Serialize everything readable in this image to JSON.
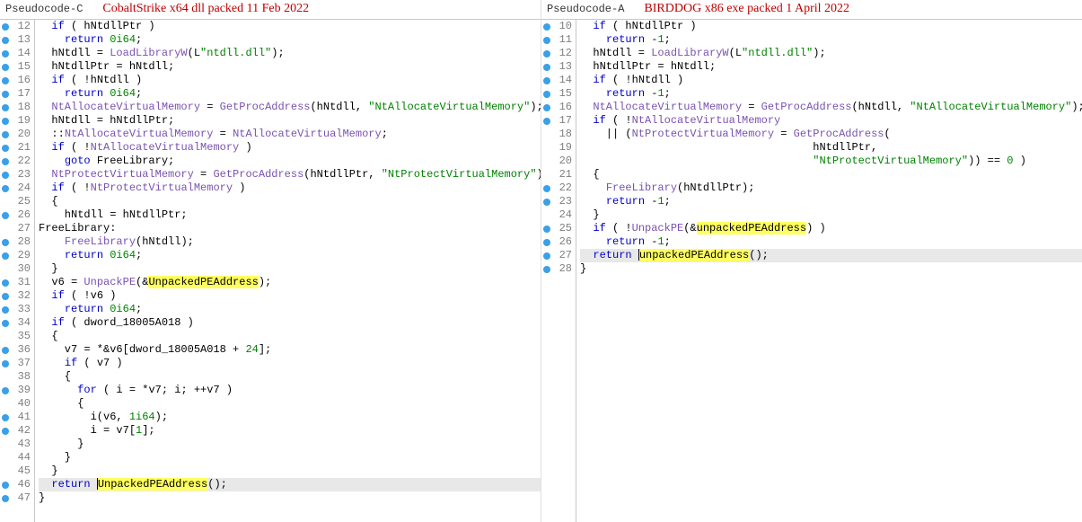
{
  "left": {
    "tab": "Pseudocode-C",
    "title": "CobaltStrike x64 dll packed 11 Feb 2022",
    "lines": [
      {
        "n": 12,
        "bp": true,
        "seg": [
          {
            "t": "  "
          },
          {
            "t": "if",
            "c": "kw"
          },
          {
            "t": " ( hNtdllPtr )"
          }
        ]
      },
      {
        "n": 13,
        "bp": true,
        "seg": [
          {
            "t": "    "
          },
          {
            "t": "return",
            "c": "kw"
          },
          {
            "t": " "
          },
          {
            "t": "0i64",
            "c": "num-lit"
          },
          {
            "t": ";"
          }
        ]
      },
      {
        "n": 14,
        "bp": true,
        "seg": [
          {
            "t": "  hNtdll = "
          },
          {
            "t": "LoadLibraryW",
            "c": "fn"
          },
          {
            "t": "(L"
          },
          {
            "t": "\"ntdll.dll\"",
            "c": "str"
          },
          {
            "t": ");"
          }
        ]
      },
      {
        "n": 15,
        "bp": true,
        "seg": [
          {
            "t": "  hNtdllPtr = hNtdll;"
          }
        ]
      },
      {
        "n": 16,
        "bp": true,
        "seg": [
          {
            "t": "  "
          },
          {
            "t": "if",
            "c": "kw"
          },
          {
            "t": " ( !hNtdll )"
          }
        ]
      },
      {
        "n": 17,
        "bp": true,
        "seg": [
          {
            "t": "    "
          },
          {
            "t": "return",
            "c": "kw"
          },
          {
            "t": " "
          },
          {
            "t": "0i64",
            "c": "num-lit"
          },
          {
            "t": ";"
          }
        ]
      },
      {
        "n": 18,
        "bp": true,
        "seg": [
          {
            "t": "  "
          },
          {
            "t": "NtAllocateVirtualMemory",
            "c": "fn"
          },
          {
            "t": " = "
          },
          {
            "t": "GetProcAddress",
            "c": "fn"
          },
          {
            "t": "(hNtdll, "
          },
          {
            "t": "\"NtAllocateVirtualMemory\"",
            "c": "str"
          },
          {
            "t": ");"
          }
        ]
      },
      {
        "n": 19,
        "bp": true,
        "seg": [
          {
            "t": "  hNtdll = hNtdllPtr;"
          }
        ]
      },
      {
        "n": 20,
        "bp": true,
        "seg": [
          {
            "t": "  ::"
          },
          {
            "t": "NtAllocateVirtualMemory",
            "c": "fn"
          },
          {
            "t": " = "
          },
          {
            "t": "NtAllocateVirtualMemory",
            "c": "fn"
          },
          {
            "t": ";"
          }
        ]
      },
      {
        "n": 21,
        "bp": true,
        "seg": [
          {
            "t": "  "
          },
          {
            "t": "if",
            "c": "kw"
          },
          {
            "t": " ( !"
          },
          {
            "t": "NtAllocateVirtualMemory",
            "c": "fn"
          },
          {
            "t": " )"
          }
        ]
      },
      {
        "n": 22,
        "bp": true,
        "seg": [
          {
            "t": "    "
          },
          {
            "t": "goto",
            "c": "kw"
          },
          {
            "t": " FreeLibrary;"
          }
        ]
      },
      {
        "n": 23,
        "bp": true,
        "seg": [
          {
            "t": "  "
          },
          {
            "t": "NtProtectVirtualMemory",
            "c": "fn"
          },
          {
            "t": " = "
          },
          {
            "t": "GetProcAddress",
            "c": "fn"
          },
          {
            "t": "(hNtdllPtr, "
          },
          {
            "t": "\"NtProtectVirtualMemory\"",
            "c": "str"
          },
          {
            "t": ");"
          }
        ]
      },
      {
        "n": 24,
        "bp": true,
        "seg": [
          {
            "t": "  "
          },
          {
            "t": "if",
            "c": "kw"
          },
          {
            "t": " ( !"
          },
          {
            "t": "NtProtectVirtualMemory",
            "c": "fn"
          },
          {
            "t": " )"
          }
        ]
      },
      {
        "n": 25,
        "bp": false,
        "seg": [
          {
            "t": "  {"
          }
        ]
      },
      {
        "n": 26,
        "bp": true,
        "seg": [
          {
            "t": "    hNtdll = hNtdllPtr;"
          }
        ]
      },
      {
        "n": 27,
        "bp": false,
        "seg": [
          {
            "t": "FreeLibrary:"
          }
        ]
      },
      {
        "n": 28,
        "bp": true,
        "seg": [
          {
            "t": "    "
          },
          {
            "t": "FreeLibrary",
            "c": "fn"
          },
          {
            "t": "(hNtdll);"
          }
        ]
      },
      {
        "n": 29,
        "bp": true,
        "seg": [
          {
            "t": "    "
          },
          {
            "t": "return",
            "c": "kw"
          },
          {
            "t": " "
          },
          {
            "t": "0i64",
            "c": "num-lit"
          },
          {
            "t": ";"
          }
        ]
      },
      {
        "n": 30,
        "bp": false,
        "seg": [
          {
            "t": "  }"
          }
        ]
      },
      {
        "n": 31,
        "bp": true,
        "seg": [
          {
            "t": "  v6 = "
          },
          {
            "t": "UnpackPE",
            "c": "fn"
          },
          {
            "t": "(&"
          },
          {
            "t": "UnpackedPEAddress",
            "hi": true
          },
          {
            "t": ");"
          }
        ]
      },
      {
        "n": 32,
        "bp": true,
        "seg": [
          {
            "t": "  "
          },
          {
            "t": "if",
            "c": "kw"
          },
          {
            "t": " ( !v6 )"
          }
        ]
      },
      {
        "n": 33,
        "bp": true,
        "seg": [
          {
            "t": "    "
          },
          {
            "t": "return",
            "c": "kw"
          },
          {
            "t": " "
          },
          {
            "t": "0i64",
            "c": "num-lit"
          },
          {
            "t": ";"
          }
        ]
      },
      {
        "n": 34,
        "bp": true,
        "seg": [
          {
            "t": "  "
          },
          {
            "t": "if",
            "c": "kw"
          },
          {
            "t": " ( dword_18005A018 )"
          }
        ]
      },
      {
        "n": 35,
        "bp": false,
        "seg": [
          {
            "t": "  {"
          }
        ]
      },
      {
        "n": 36,
        "bp": true,
        "seg": [
          {
            "t": "    v7 = *&v6[dword_18005A018 + "
          },
          {
            "t": "24",
            "c": "num-lit"
          },
          {
            "t": "];"
          }
        ]
      },
      {
        "n": 37,
        "bp": true,
        "seg": [
          {
            "t": "    "
          },
          {
            "t": "if",
            "c": "kw"
          },
          {
            "t": " ( v7 )"
          }
        ]
      },
      {
        "n": 38,
        "bp": false,
        "seg": [
          {
            "t": "    {"
          }
        ]
      },
      {
        "n": 39,
        "bp": true,
        "seg": [
          {
            "t": "      "
          },
          {
            "t": "for",
            "c": "kw"
          },
          {
            "t": " ( i = *v7; i; ++v7 )"
          }
        ]
      },
      {
        "n": 40,
        "bp": false,
        "seg": [
          {
            "t": "      {"
          }
        ]
      },
      {
        "n": 41,
        "bp": true,
        "seg": [
          {
            "t": "        i(v6, "
          },
          {
            "t": "1i64",
            "c": "num-lit"
          },
          {
            "t": ");"
          }
        ]
      },
      {
        "n": 42,
        "bp": true,
        "seg": [
          {
            "t": "        i = v7["
          },
          {
            "t": "1",
            "c": "num-lit"
          },
          {
            "t": "];"
          }
        ]
      },
      {
        "n": 43,
        "bp": false,
        "seg": [
          {
            "t": "      }"
          }
        ]
      },
      {
        "n": 44,
        "bp": false,
        "seg": [
          {
            "t": "    }"
          }
        ]
      },
      {
        "n": 45,
        "bp": false,
        "seg": [
          {
            "t": "  }"
          }
        ]
      },
      {
        "n": 46,
        "bp": true,
        "cur": true,
        "seg": [
          {
            "t": "  "
          },
          {
            "t": "return",
            "c": "kw"
          },
          {
            "t": " "
          },
          {
            "caret": true
          },
          {
            "t": "UnpackedPEAddress",
            "hi": true
          },
          {
            "t": "();"
          }
        ]
      },
      {
        "n": 47,
        "bp": true,
        "seg": [
          {
            "t": "}"
          }
        ]
      }
    ]
  },
  "right": {
    "tab": "Pseudocode-A",
    "title": "BIRDDOG x86 exe packed 1 April 2022",
    "lines": [
      {
        "n": 10,
        "bp": true,
        "seg": [
          {
            "t": "  "
          },
          {
            "t": "if",
            "c": "kw"
          },
          {
            "t": " ( hNtdllPtr )"
          }
        ]
      },
      {
        "n": 11,
        "bp": true,
        "seg": [
          {
            "t": "    "
          },
          {
            "t": "return",
            "c": "kw"
          },
          {
            "t": " -"
          },
          {
            "t": "1",
            "c": "num-lit"
          },
          {
            "t": ";"
          }
        ]
      },
      {
        "n": 12,
        "bp": true,
        "seg": [
          {
            "t": "  hNtdll = "
          },
          {
            "t": "LoadLibraryW",
            "c": "fn"
          },
          {
            "t": "(L"
          },
          {
            "t": "\"ntdll.dll\"",
            "c": "str"
          },
          {
            "t": ");"
          }
        ]
      },
      {
        "n": 13,
        "bp": true,
        "seg": [
          {
            "t": "  hNtdllPtr = hNtdll;"
          }
        ]
      },
      {
        "n": 14,
        "bp": true,
        "seg": [
          {
            "t": "  "
          },
          {
            "t": "if",
            "c": "kw"
          },
          {
            "t": " ( !hNtdll )"
          }
        ]
      },
      {
        "n": 15,
        "bp": true,
        "seg": [
          {
            "t": "    "
          },
          {
            "t": "return",
            "c": "kw"
          },
          {
            "t": " -"
          },
          {
            "t": "1",
            "c": "num-lit"
          },
          {
            "t": ";"
          }
        ]
      },
      {
        "n": 16,
        "bp": true,
        "seg": [
          {
            "t": "  "
          },
          {
            "t": "NtAllocateVirtualMemory",
            "c": "fn"
          },
          {
            "t": " = "
          },
          {
            "t": "GetProcAddress",
            "c": "fn"
          },
          {
            "t": "(hNtdll, "
          },
          {
            "t": "\"NtAllocateVirtualMemory\"",
            "c": "str"
          },
          {
            "t": ");"
          }
        ]
      },
      {
        "n": 17,
        "bp": true,
        "seg": [
          {
            "t": "  "
          },
          {
            "t": "if",
            "c": "kw"
          },
          {
            "t": " ( !"
          },
          {
            "t": "NtAllocateVirtualMemory",
            "c": "fn"
          }
        ]
      },
      {
        "n": 18,
        "bp": false,
        "seg": [
          {
            "t": "    || ("
          },
          {
            "t": "NtProtectVirtualMemory",
            "c": "fn"
          },
          {
            "t": " = "
          },
          {
            "t": "GetProcAddress",
            "c": "fn"
          },
          {
            "t": "("
          }
        ]
      },
      {
        "n": 19,
        "bp": false,
        "seg": [
          {
            "t": "                                    hNtdllPtr,"
          }
        ]
      },
      {
        "n": 20,
        "bp": false,
        "seg": [
          {
            "t": "                                    "
          },
          {
            "t": "\"NtProtectVirtualMemory\"",
            "c": "str"
          },
          {
            "t": ")) == "
          },
          {
            "t": "0",
            "c": "num-lit"
          },
          {
            "t": " )"
          }
        ]
      },
      {
        "n": 21,
        "bp": false,
        "seg": [
          {
            "t": "  {"
          }
        ]
      },
      {
        "n": 22,
        "bp": true,
        "seg": [
          {
            "t": "    "
          },
          {
            "t": "FreeLibrary",
            "c": "fn"
          },
          {
            "t": "(hNtdllPtr);"
          }
        ]
      },
      {
        "n": 23,
        "bp": true,
        "seg": [
          {
            "t": "    "
          },
          {
            "t": "return",
            "c": "kw"
          },
          {
            "t": " -"
          },
          {
            "t": "1",
            "c": "num-lit"
          },
          {
            "t": ";"
          }
        ]
      },
      {
        "n": 24,
        "bp": false,
        "seg": [
          {
            "t": "  }"
          }
        ]
      },
      {
        "n": 25,
        "bp": true,
        "seg": [
          {
            "t": "  "
          },
          {
            "t": "if",
            "c": "kw"
          },
          {
            "t": " ( !"
          },
          {
            "t": "UnpackPE",
            "c": "fn"
          },
          {
            "t": "(&"
          },
          {
            "t": "unpackedPEAddress",
            "hi": true
          },
          {
            "t": ") )"
          }
        ]
      },
      {
        "n": 26,
        "bp": true,
        "seg": [
          {
            "t": "    "
          },
          {
            "t": "return",
            "c": "kw"
          },
          {
            "t": " -"
          },
          {
            "t": "1",
            "c": "num-lit"
          },
          {
            "t": ";"
          }
        ]
      },
      {
        "n": 27,
        "bp": true,
        "cur": true,
        "seg": [
          {
            "t": "  "
          },
          {
            "t": "return",
            "c": "kw"
          },
          {
            "t": " "
          },
          {
            "caret": true
          },
          {
            "t": "unpackedPEAddress",
            "hi": true
          },
          {
            "t": "();"
          }
        ]
      },
      {
        "n": 28,
        "bp": true,
        "seg": [
          {
            "t": "}"
          }
        ]
      }
    ]
  }
}
